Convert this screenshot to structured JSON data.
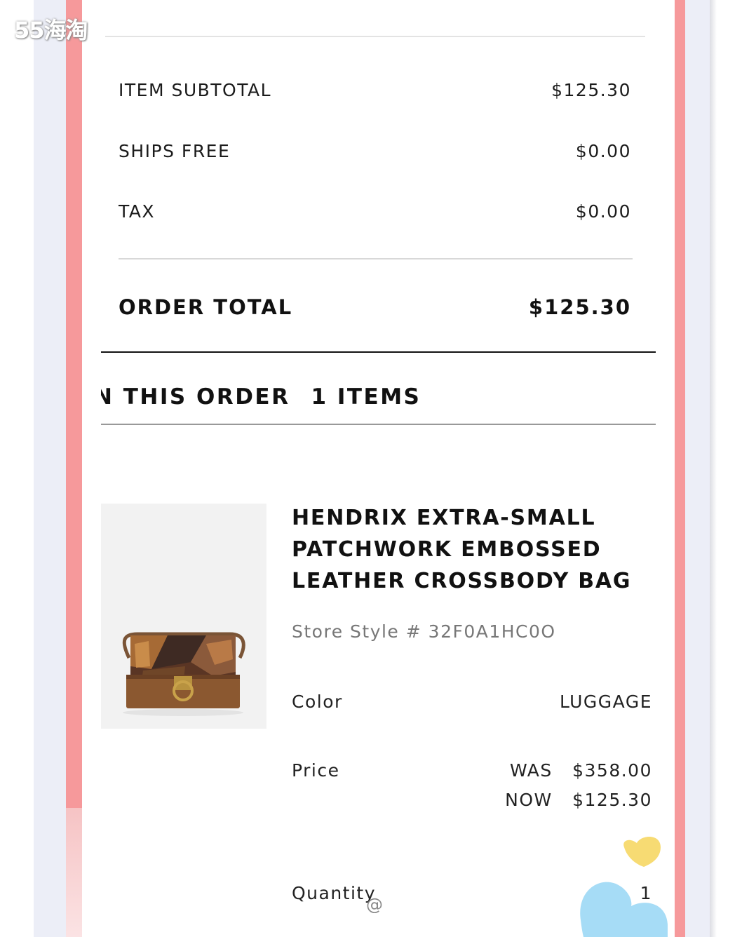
{
  "watermark": "55海淘",
  "summary": {
    "rows": [
      {
        "label": "ITEM SUBTOTAL",
        "value": "$125.30"
      },
      {
        "label": "SHIPS FREE",
        "value": "$0.00"
      },
      {
        "label": "TAX",
        "value": "$0.00"
      }
    ],
    "total_label": "ORDER TOTAL",
    "total_value": "$125.30"
  },
  "order": {
    "heading": "N THIS ORDER",
    "count": "1 ITEMS"
  },
  "product": {
    "title_lines": [
      "HENDRIX EXTRA-SMALL",
      "PATCHWORK EMBOSSED",
      "LEATHER CROSSBODY BAG"
    ],
    "style": "Store Style # 32F0A1HC0O",
    "color_label": "Color",
    "color_value": "LUGGAGE",
    "price_label": "Price",
    "was": "WAS   $358.00",
    "now": "NOW   $125.30",
    "quantity_label": "Quantity",
    "quantity_value": "1"
  },
  "overlay": {
    "at_symbol": "@"
  },
  "colors": {
    "accent_pink": "#f6999b",
    "lavender": "#eceef7",
    "heart_yellow": "#f7db73",
    "heart_blue": "#a6dcf6"
  }
}
